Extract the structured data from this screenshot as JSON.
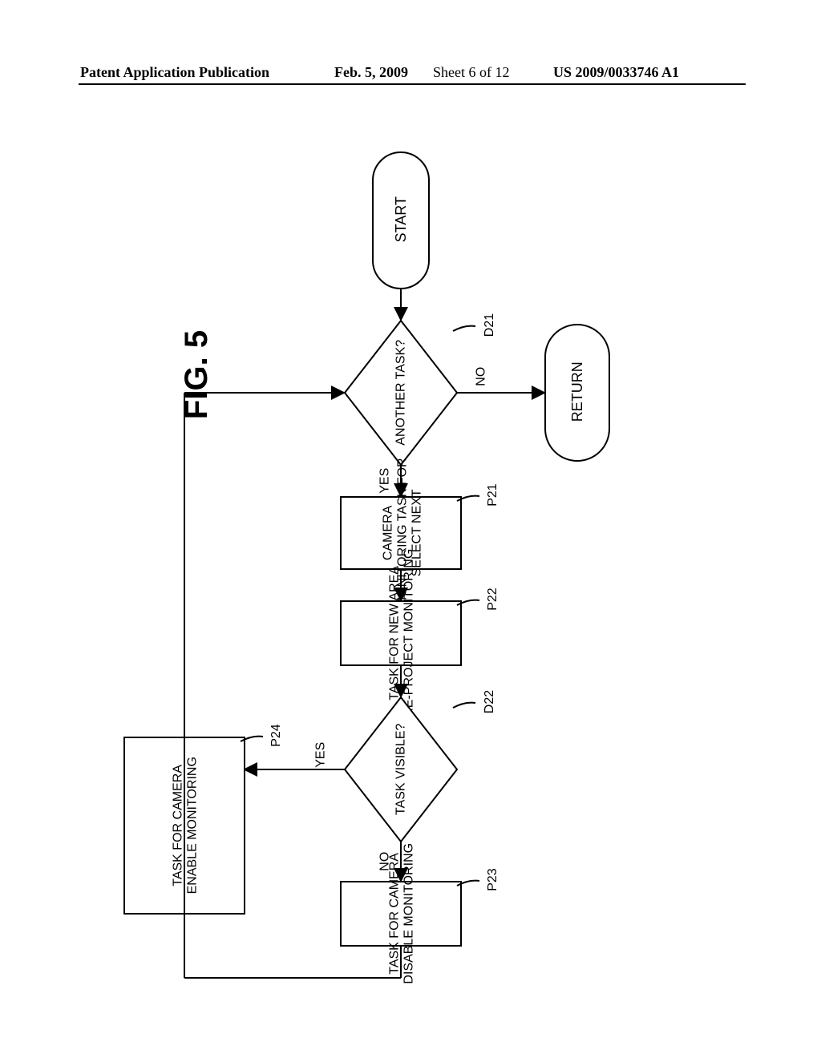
{
  "header": {
    "publication_label": "Patent Application Publication",
    "date": "Feb. 5, 2009",
    "sheet": "Sheet 6 of 12",
    "pub_number": "US 2009/0033746 A1"
  },
  "figure": {
    "title": "FIG. 5",
    "start": "START",
    "return": "RETURN",
    "d21": {
      "id": "D21",
      "text": "ANOTHER TASK?",
      "yes": "YES",
      "no": "NO"
    },
    "p21": {
      "id": "P21",
      "line1": "SELECT NEXT",
      "line2": "MONITORING TASK FOR",
      "line3": "CAMERA"
    },
    "p22": {
      "id": "P22",
      "line1": "RE-PROJECT MONITORING",
      "line2": "TASK FOR NEW AREA"
    },
    "d22": {
      "id": "D22",
      "text": "TASK VISIBLE?",
      "yes": "YES",
      "no": "NO"
    },
    "p23": {
      "id": "P23",
      "line1": "DISABLE MONITORING",
      "line2": "TASK FOR CAMERA"
    },
    "p24": {
      "id": "P24",
      "line1": "ENABLE MONITORING",
      "line2": "TASK FOR CAMERA"
    }
  },
  "chart_data": {
    "type": "flowchart",
    "title": "FIG. 5",
    "nodes": [
      {
        "id": "start",
        "type": "terminator",
        "text": "START"
      },
      {
        "id": "D21",
        "type": "decision",
        "text": "ANOTHER TASK?"
      },
      {
        "id": "return",
        "type": "terminator",
        "text": "RETURN"
      },
      {
        "id": "P21",
        "type": "process",
        "text": "SELECT NEXT MONITORING TASK FOR CAMERA"
      },
      {
        "id": "P22",
        "type": "process",
        "text": "RE-PROJECT MONITORING TASK FOR NEW AREA"
      },
      {
        "id": "D22",
        "type": "decision",
        "text": "TASK VISIBLE?"
      },
      {
        "id": "P23",
        "type": "process",
        "text": "DISABLE MONITORING TASK FOR CAMERA"
      },
      {
        "id": "P24",
        "type": "process",
        "text": "ENABLE MONITORING TASK FOR CAMERA"
      }
    ],
    "edges": [
      {
        "from": "start",
        "to": "D21"
      },
      {
        "from": "D21",
        "to": "return",
        "label": "NO"
      },
      {
        "from": "D21",
        "to": "P21",
        "label": "YES"
      },
      {
        "from": "P21",
        "to": "P22"
      },
      {
        "from": "P22",
        "to": "D22"
      },
      {
        "from": "D22",
        "to": "P23",
        "label": "NO"
      },
      {
        "from": "D22",
        "to": "P24",
        "label": "YES"
      },
      {
        "from": "P23",
        "to": "D21"
      },
      {
        "from": "P24",
        "to": "D21"
      }
    ]
  }
}
